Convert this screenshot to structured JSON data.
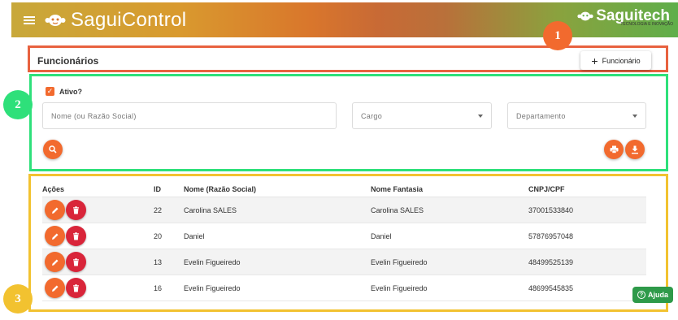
{
  "header": {
    "app_title": "SaguiControl",
    "brand_name": "Saguitech",
    "brand_sub": "TECNOLOGIA E INOVAÇÃO",
    "gradient_colors": [
      "#c8a83a",
      "#d9762c",
      "#5fae4a"
    ]
  },
  "annotations": {
    "badge_1": "1",
    "badge_2": "2",
    "badge_3": "3"
  },
  "section1": {
    "title": "Funcionários",
    "add_button_label": "Funcionário"
  },
  "filters": {
    "active_label": "Ativo?",
    "active_checked": true,
    "name_placeholder": "Nome (ou Razão Social)",
    "cargo_placeholder": "Cargo",
    "departamento_placeholder": "Departamento"
  },
  "table": {
    "headers": {
      "acoes": "Ações",
      "id": "ID",
      "nome": "Nome (Razão Social)",
      "fantasia": "Nome Fantasia",
      "cnpj": "CNPJ/CPF"
    },
    "rows": [
      {
        "id": "22",
        "nome": "Carolina SALES",
        "fantasia": "Carolina SALES",
        "cnpj": "37001533840"
      },
      {
        "id": "20",
        "nome": "Daniel",
        "fantasia": "Daniel",
        "cnpj": "57876957048"
      },
      {
        "id": "13",
        "nome": "Evelin Figueiredo",
        "fantasia": "Evelin Figueiredo",
        "cnpj": "48499525139"
      },
      {
        "id": "16",
        "nome": "Evelin Figueiredo",
        "fantasia": "Evelin Figueiredo",
        "cnpj": "48699545835"
      }
    ]
  },
  "help": {
    "label": "Ajuda"
  },
  "colors": {
    "accent": "#f26a2e",
    "danger": "#d9253a",
    "help": "#2e9a49"
  }
}
